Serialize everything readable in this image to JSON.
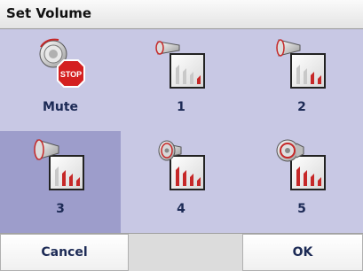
{
  "window": {
    "title": "Set Volume"
  },
  "options": [
    {
      "label": "Mute",
      "icon": "mute-icon",
      "selected": false
    },
    {
      "label": "1",
      "icon": "volume-1-icon",
      "selected": false
    },
    {
      "label": "2",
      "icon": "volume-2-icon",
      "selected": false
    },
    {
      "label": "3",
      "icon": "volume-3-icon",
      "selected": true
    },
    {
      "label": "4",
      "icon": "volume-4-icon",
      "selected": false
    },
    {
      "label": "5",
      "icon": "volume-5-icon",
      "selected": false
    }
  ],
  "buttons": {
    "cancel": "Cancel",
    "ok": "OK"
  },
  "colors": {
    "background": "#c8c8e4",
    "selected": "#9d9dcb",
    "label": "#1c2a55",
    "stop": "#d42020"
  }
}
